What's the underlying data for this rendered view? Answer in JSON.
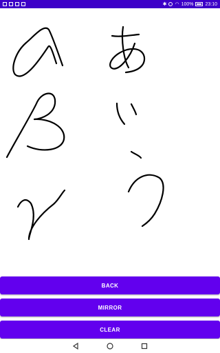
{
  "status_bar": {
    "time": "23:10",
    "battery_percent": "100%",
    "left_icons": [
      "notification-icon",
      "image-icon",
      "image-icon",
      "image-icon"
    ],
    "right_icons": [
      "bluetooth-icon",
      "vibrate-icon",
      "wifi-icon",
      "signal-icon"
    ]
  },
  "canvas": {
    "stroke_color": "#000000",
    "background": "#ffffff"
  },
  "buttons": {
    "back": "BACK",
    "mirror": "MIRROR",
    "clear": "CLEAR"
  },
  "colors": {
    "status_bar": "#3d00c8",
    "button": "#6200ee",
    "button_text": "#ffffff"
  },
  "nav_bar": {
    "items": [
      "back-icon",
      "home-icon",
      "recents-icon"
    ]
  }
}
